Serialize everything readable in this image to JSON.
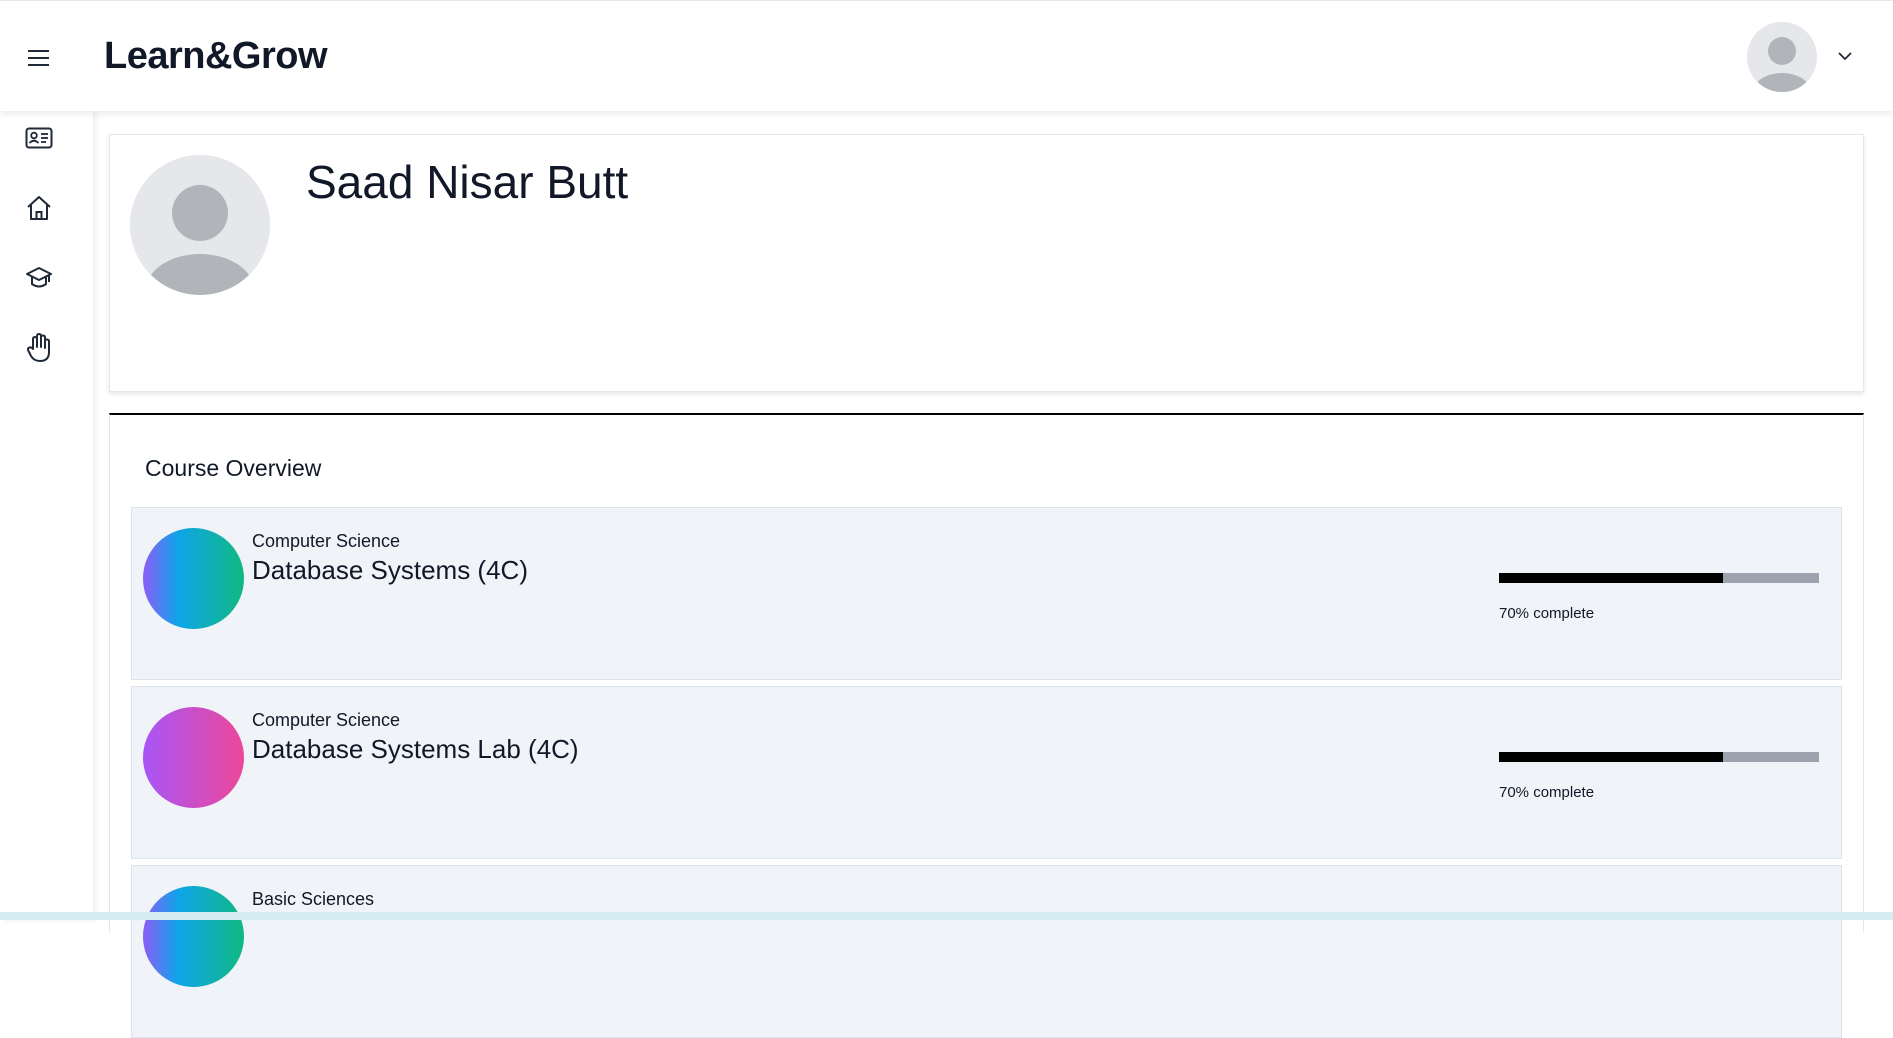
{
  "header": {
    "brand": "Learn&Grow",
    "menu_icon": "hamburger-menu-icon",
    "avatar_icon": "user-avatar-icon",
    "dropdown_icon": "chevron-down-icon"
  },
  "sidebar": {
    "items": [
      {
        "icon": "id-card-icon"
      },
      {
        "icon": "home-icon"
      },
      {
        "icon": "graduation-cap-icon"
      },
      {
        "icon": "raised-hand-icon"
      }
    ]
  },
  "profile": {
    "name": "Saad Nisar Butt",
    "avatar_icon": "user-avatar-icon"
  },
  "overview": {
    "title": "Course Overview",
    "courses": [
      {
        "category": "Computer Science",
        "name": "Database Systems (4C)",
        "progress": 70,
        "progress_text": "70% complete",
        "gradient": [
          "#8b5cf6",
          "#0ea5e9",
          "#10b981"
        ]
      },
      {
        "category": "Computer Science",
        "name": "Database Systems Lab (4C)",
        "progress": 70,
        "progress_text": "70% complete",
        "gradient": [
          "#a855f7",
          "#ec4899"
        ]
      },
      {
        "category": "Basic Sciences",
        "name": "",
        "progress": null,
        "progress_text": "",
        "gradient": [
          "#8b5cf6",
          "#0ea5e9",
          "#10b981"
        ]
      }
    ]
  },
  "colors": {
    "card_bg": "#f0f3f8",
    "progress_fill": "#000000",
    "progress_track": "#9ca3af",
    "avatar_bg": "#e5e7eb",
    "avatar_fg": "#b1b5ba"
  }
}
